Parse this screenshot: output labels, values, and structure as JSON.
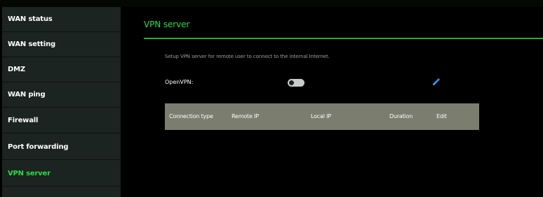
{
  "sidebar": {
    "items": [
      {
        "label": "WAN status",
        "active": false
      },
      {
        "label": "WAN setting",
        "active": false
      },
      {
        "label": "DMZ",
        "active": false
      },
      {
        "label": "WAN ping",
        "active": false
      },
      {
        "label": "Firewall",
        "active": false
      },
      {
        "label": "Port forwarding",
        "active": false
      },
      {
        "label": "VPN server",
        "active": true
      }
    ]
  },
  "main": {
    "title": "VPN server",
    "description": "Setup VPN server for remote user to connect to the internal Internet.",
    "openvpn": {
      "label": "OpenVPN:",
      "enabled": false,
      "edit_icon": "pencil-icon"
    },
    "table": {
      "headers": [
        "Connection type",
        "Remote IP",
        "Local IP",
        "Duration",
        "Edit"
      ],
      "rows": []
    }
  },
  "colors": {
    "accent": "#2bdc43",
    "sidebar_bg": "#1b2420",
    "table_header_bg": "#7b7d6e"
  }
}
